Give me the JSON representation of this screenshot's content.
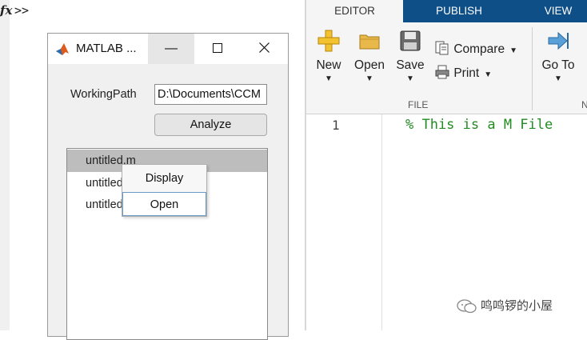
{
  "command_window": {
    "fx": "fx",
    "prompt": ">>"
  },
  "editor": {
    "tabs": [
      {
        "label": "EDITOR",
        "active": true
      },
      {
        "label": "PUBLISH",
        "active": false
      },
      {
        "label": "VIEW",
        "active": false
      }
    ],
    "ribbon": {
      "new_label": "New",
      "open_label": "Open",
      "save_label": "Save",
      "compare_label": "Compare",
      "print_label": "Print",
      "goto_label": "Go To",
      "file_group_label": "FILE",
      "nav_group_label_partial": "N"
    },
    "line_number": "1",
    "code": "% This is a M File"
  },
  "app_window": {
    "title": "MATLAB ...",
    "working_path_label": "WorkingPath",
    "working_path_value": "D:\\Documents\\CCM",
    "analyze_label": "Analyze",
    "list_items": [
      "untitled.m",
      "untitled",
      "untitled"
    ],
    "selected_index": 0
  },
  "context_menu": {
    "items": [
      "Display",
      "Open"
    ],
    "focused_index": 1
  },
  "watermark": {
    "text": "鸣鸣锣的小屋"
  },
  "colors": {
    "tab_strip": "#0f4f88",
    "code_comment": "#228b22",
    "selection": "#bdbdbd"
  }
}
